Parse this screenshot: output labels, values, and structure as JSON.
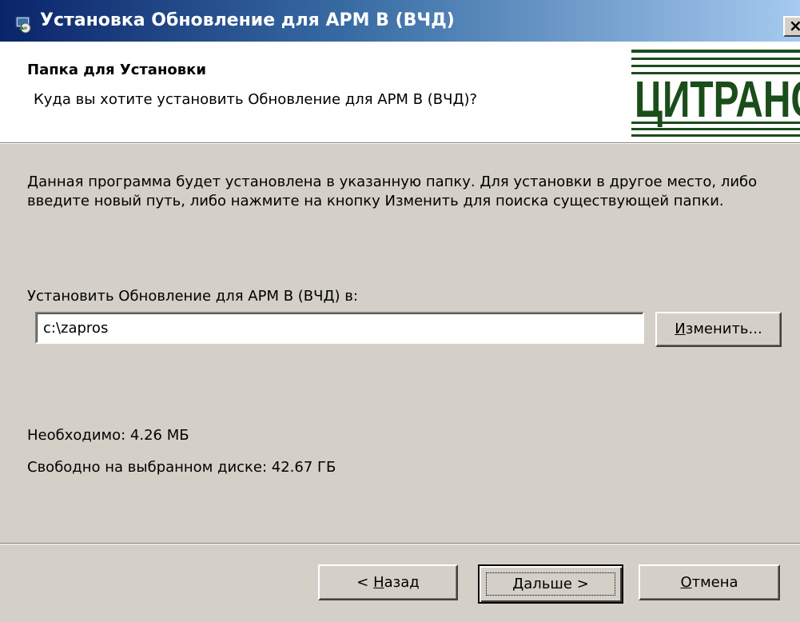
{
  "window": {
    "title": "Установка Обновление для АРМ В (ВЧД)",
    "close_label": "×"
  },
  "header": {
    "title": "Папка для Установки",
    "subtitle": "Куда вы хотите установить Обновление для АРМ В (ВЧД)?",
    "logo_text": "ЦИТРАНС"
  },
  "body": {
    "description": "Данная программа будет установлена в указанную папку. Для установки в другое место, либо введите новый путь, либо нажмите на кнопку Изменить для поиска существующей папки.",
    "install_label": "Установить Обновление для АРМ В (ВЧД) в:",
    "path_value": "c:\\zapros",
    "change_button": {
      "mnemonic": "И",
      "rest": "зменить..."
    },
    "required": "Необходимо: 4.26 МБ",
    "free_space": "Свободно на выбранном диске: 42.67 ГБ"
  },
  "footer": {
    "back_button": {
      "prefix": "< ",
      "mnemonic": "Н",
      "rest": "азад"
    },
    "next_button": {
      "mnemonic": "Д",
      "rest": "альше >"
    },
    "cancel_button": {
      "mnemonic": "О",
      "rest": "тмена"
    }
  },
  "colors": {
    "titlebar_start": "#0a246a",
    "titlebar_end": "#a6caf0",
    "window_bg": "#d4d0c8",
    "logo_green": "#1a4d1a"
  },
  "icons": {
    "app_icon": "installer-icon",
    "close_icon": "close-icon"
  }
}
